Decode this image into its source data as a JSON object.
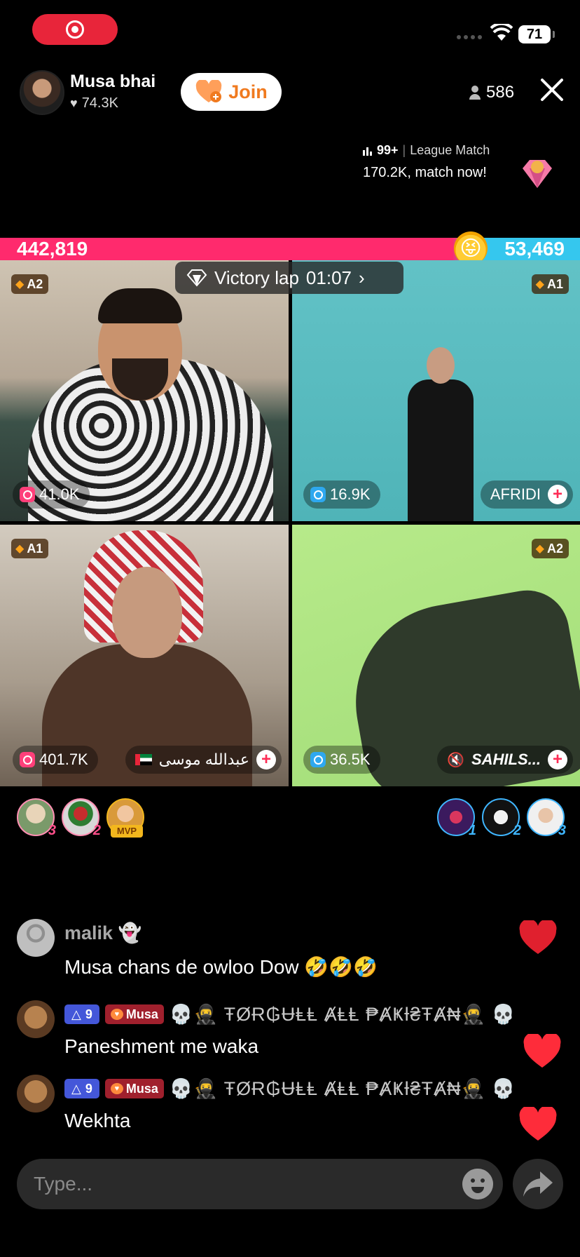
{
  "status": {
    "battery": "71"
  },
  "host": {
    "name": "Musa bhai",
    "likes": "74.3K",
    "join_label": "Join",
    "viewers": "586"
  },
  "league": {
    "rank": "99+",
    "label": "League Match",
    "cta": "170.2K, match now!"
  },
  "scores": {
    "left": "442,819",
    "right": "53,469"
  },
  "victory": {
    "label": "Victory lap",
    "timer": "01:07"
  },
  "cells": [
    {
      "tag": "A2",
      "count": "41.0K",
      "name": ""
    },
    {
      "tag": "A1",
      "count": "16.9K",
      "name": "AFRIDI"
    },
    {
      "tag": "A1",
      "count": "401.7K",
      "name": "عبدالله موسى"
    },
    {
      "tag": "A2",
      "count": "36.5K",
      "name": "SAHILS..."
    }
  ],
  "gifters": {
    "left": [
      {
        "rank": "3"
      },
      {
        "rank": "2"
      },
      {
        "mvp": "MVP"
      }
    ],
    "right": [
      {
        "rank": "1"
      },
      {
        "rank": "2"
      },
      {
        "rank": "3"
      }
    ]
  },
  "comments": [
    {
      "user": "malik 👻",
      "text": "Musa chans de owloo Dow 🤣🤣🤣"
    },
    {
      "level": "9",
      "fan": "Musa",
      "user": "💀🥷 ŦØɌ₲ɄⱠⱠ ȺⱠⱠ ₱ȺҜƗ₴ŦȺ₦🥷 💀",
      "text": "Paneshment me waka"
    },
    {
      "level": "9",
      "fan": "Musa",
      "user": "💀🥷 ŦØɌ₲ɄⱠⱠ ȺⱠⱠ ₱ȺҜƗ₴ŦȺ₦🥷 💀",
      "text": "Wekhta"
    }
  ],
  "input": {
    "placeholder": "Type..."
  },
  "colors": {
    "accent": "#fe2c55",
    "score_left": "#ff2a6d",
    "score_right": "#35c7ee",
    "join": "#f07a1f"
  }
}
